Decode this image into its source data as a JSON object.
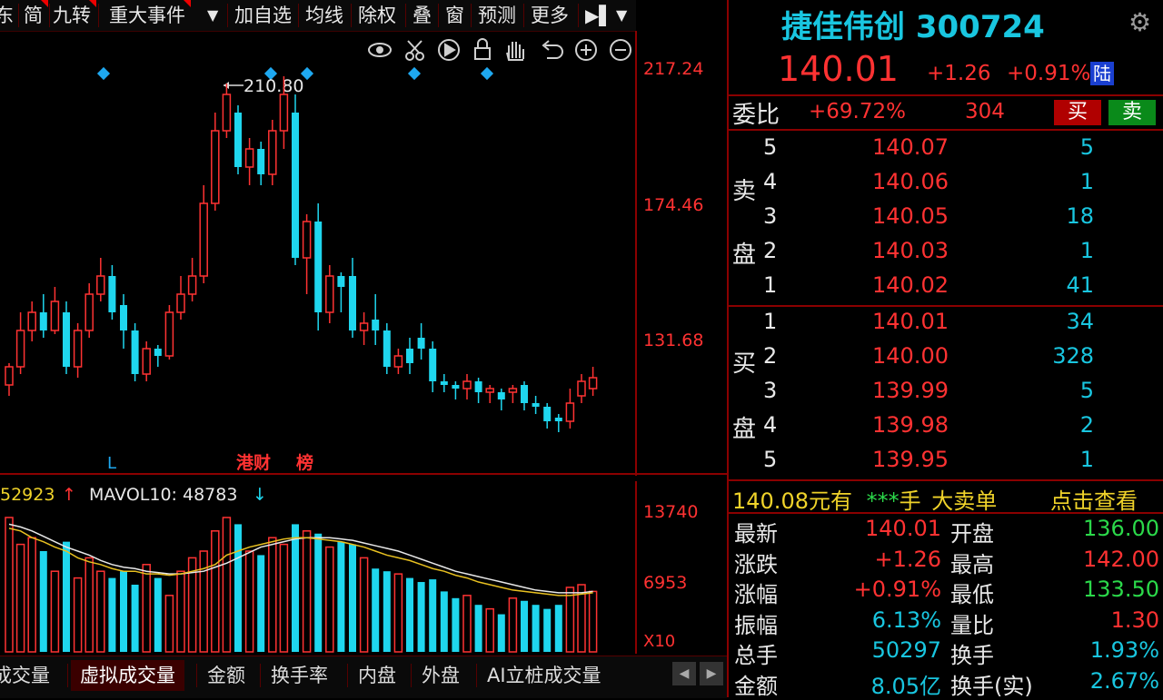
{
  "toolbar": {
    "items": [
      {
        "label": "东",
        "flag": false
      },
      {
        "label": "简",
        "flag": true
      },
      {
        "label": "九转",
        "flag": true
      },
      {
        "label": "重大事件",
        "flag": true
      },
      {
        "label": "加自选",
        "flag": false
      },
      {
        "label": "均线",
        "flag": false
      },
      {
        "label": "除权",
        "flag": false
      },
      {
        "label": "叠",
        "flag": false
      },
      {
        "label": "窗",
        "flag": false
      },
      {
        "label": "预测",
        "flag": false
      },
      {
        "label": "更多",
        "flag": false
      }
    ]
  },
  "chart": {
    "price_ticks": [
      "217.24",
      "174.46",
      "131.68"
    ],
    "volume_ticks": [
      "13740",
      "6953",
      "X10"
    ],
    "high_marker": "210.80",
    "bottom_labels": [
      "L",
      "港财",
      "榜"
    ],
    "vol_label": "52923",
    "mavol_label": "MAVOL10: 48783"
  },
  "chart_data": {
    "type": "candlestick",
    "ylim": [
      120,
      225
    ],
    "candles": [
      [
        135,
        140,
        132,
        141
      ],
      [
        140,
        150,
        138,
        155
      ],
      [
        150,
        155,
        147,
        158
      ],
      [
        155,
        150,
        148,
        160
      ],
      [
        150,
        158,
        149,
        162
      ],
      [
        155,
        140,
        138,
        158
      ],
      [
        140,
        150,
        137,
        152
      ],
      [
        150,
        160,
        148,
        163
      ],
      [
        160,
        165,
        158,
        170
      ],
      [
        165,
        155,
        153,
        168
      ],
      [
        157,
        150,
        145,
        160
      ],
      [
        150,
        138,
        136,
        152
      ],
      [
        138,
        145,
        136,
        147
      ],
      [
        145,
        143,
        140,
        146
      ],
      [
        143,
        155,
        142,
        157
      ],
      [
        155,
        160,
        153,
        165
      ],
      [
        160,
        165,
        158,
        170
      ],
      [
        165,
        185,
        163,
        190
      ],
      [
        185,
        205,
        183,
        210
      ],
      [
        205,
        215,
        203,
        218
      ],
      [
        210,
        195,
        193,
        212
      ],
      [
        195,
        200,
        190,
        203
      ],
      [
        200,
        193,
        190,
        202
      ],
      [
        193,
        205,
        190,
        208
      ],
      [
        205,
        215,
        200,
        220
      ],
      [
        210,
        170,
        168,
        215
      ],
      [
        170,
        180,
        160,
        182
      ],
      [
        180,
        155,
        150,
        185
      ],
      [
        155,
        165,
        152,
        168
      ],
      [
        165,
        162,
        155,
        166
      ],
      [
        165,
        150,
        148,
        170
      ],
      [
        150,
        152,
        146,
        155
      ],
      [
        153,
        150,
        146,
        160
      ],
      [
        150,
        140,
        138,
        152
      ],
      [
        140,
        143,
        138,
        145
      ],
      [
        145,
        141,
        138,
        148
      ],
      [
        148,
        145,
        142,
        152
      ],
      [
        145,
        136,
        133,
        147
      ],
      [
        136,
        135,
        133,
        138
      ],
      [
        135,
        134,
        131,
        136
      ],
      [
        134,
        136,
        131,
        138
      ],
      [
        136,
        133,
        130,
        137
      ],
      [
        133,
        134,
        130,
        135
      ],
      [
        133,
        131,
        128,
        134
      ],
      [
        133,
        134,
        130,
        135
      ],
      [
        135,
        130,
        128,
        136
      ],
      [
        130,
        129,
        127,
        132
      ],
      [
        129,
        125,
        123,
        130
      ],
      [
        126,
        125,
        122,
        127
      ],
      [
        125,
        130,
        123,
        134
      ],
      [
        132,
        136,
        130,
        138
      ],
      [
        134,
        137,
        132,
        140
      ]
    ],
    "volumes": [
      100,
      80,
      85,
      75,
      60,
      82,
      55,
      70,
      60,
      55,
      60,
      50,
      65,
      55,
      42,
      60,
      70,
      75,
      90,
      100,
      95,
      75,
      72,
      85,
      80,
      95,
      90,
      88,
      78,
      82,
      80,
      70,
      62,
      60,
      58,
      55,
      52,
      54,
      45,
      40,
      42,
      35,
      32,
      28,
      40,
      38,
      35,
      32,
      35,
      48,
      50,
      45
    ],
    "mavol": [
      92,
      90,
      85,
      82,
      78,
      75,
      70,
      67,
      65,
      62,
      60,
      60,
      58,
      58,
      57,
      58,
      60,
      62,
      65,
      72,
      75,
      78,
      80,
      82,
      84,
      85,
      85,
      84,
      83,
      82,
      80,
      78,
      75,
      72,
      70,
      68,
      65,
      62,
      60,
      57,
      55,
      52,
      50,
      48,
      46,
      45,
      44,
      43,
      42,
      42,
      43,
      44
    ],
    "mavol2": [
      95,
      93,
      90,
      86,
      82,
      78,
      75,
      72,
      68,
      65,
      63,
      62,
      60,
      59,
      58,
      58,
      59,
      60,
      63,
      66,
      70,
      74,
      78,
      80,
      82,
      84,
      85,
      85,
      85,
      84,
      83,
      81,
      79,
      77,
      75,
      72,
      69,
      66,
      63,
      60,
      58,
      56,
      54,
      52,
      50,
      48,
      46,
      45,
      44,
      44,
      44,
      45
    ]
  },
  "tabs": [
    "成交量",
    "虚拟成交量",
    "金额",
    "换手率",
    "内盘",
    "外盘",
    "AI立桩成交量"
  ],
  "quote": {
    "name": "捷佳伟创",
    "code": "300724",
    "price": "140.01",
    "change": "+1.26",
    "change_pct": "+0.91%",
    "market_badge": "陆",
    "weibi_label": "委比",
    "weibi_value": "+69.72%",
    "weicha": "304",
    "buy_label": "买",
    "sell_label": "卖",
    "sell_side_label1": "卖",
    "sell_side_label2": "盘",
    "buy_side_label1": "买",
    "buy_side_label2": "盘",
    "asks": [
      {
        "level": "5",
        "price": "140.07",
        "vol": "5"
      },
      {
        "level": "4",
        "price": "140.06",
        "vol": "1"
      },
      {
        "level": "3",
        "price": "140.05",
        "vol": "18"
      },
      {
        "level": "2",
        "price": "140.03",
        "vol": "1"
      },
      {
        "level": "1",
        "price": "140.02",
        "vol": "41"
      }
    ],
    "bids": [
      {
        "level": "1",
        "price": "140.01",
        "vol": "34"
      },
      {
        "level": "2",
        "price": "140.00",
        "vol": "328"
      },
      {
        "level": "3",
        "price": "139.99",
        "vol": "5"
      },
      {
        "level": "4",
        "price": "139.98",
        "vol": "2"
      },
      {
        "level": "5",
        "price": "139.95",
        "vol": "1"
      }
    ],
    "big_order": {
      "price": "140.08",
      "text1": "元有",
      "stars": "***",
      "unit": "手",
      "text2": "大卖单",
      "link": "点击查看"
    },
    "stats": [
      {
        "k1": "最新",
        "v1": "140.01",
        "c1": "r",
        "k2": "开盘",
        "v2": "136.00",
        "c2": "g"
      },
      {
        "k1": "涨跌",
        "v1": "+1.26",
        "c1": "r",
        "k2": "最高",
        "v2": "142.00",
        "c2": "r"
      },
      {
        "k1": "涨幅",
        "v1": "+0.91%",
        "c1": "r",
        "k2": "最低",
        "v2": "133.50",
        "c2": "g"
      },
      {
        "k1": "振幅",
        "v1": "6.13%",
        "c1": "c",
        "k2": "量比",
        "v2": "1.30",
        "c2": "r"
      },
      {
        "k1": "总手",
        "v1": "50297",
        "c1": "c",
        "k2": "换手",
        "v2": "1.93%",
        "c2": "c"
      },
      {
        "k1": "金额",
        "v1": "8.05亿",
        "c1": "c",
        "k2": "换手(实)",
        "v2": "2.67%",
        "c2": "c"
      }
    ]
  },
  "colors": {
    "up": "#ff3232",
    "down": "#1fd6ee",
    "ma": "#e8c020",
    "grid": "#8b0000"
  }
}
